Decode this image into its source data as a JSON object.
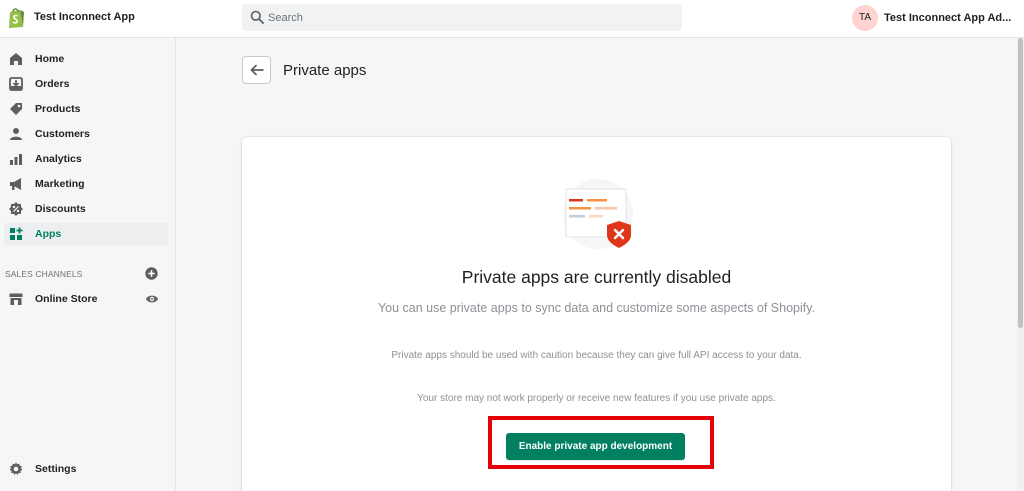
{
  "topbar": {
    "store_name": "Test Inconnect App",
    "search_placeholder": "Search",
    "user_initials": "TA",
    "user_name": "Test Inconnect App Ad..."
  },
  "sidebar": {
    "items": [
      {
        "label": "Home",
        "icon": "home-icon"
      },
      {
        "label": "Orders",
        "icon": "orders-icon"
      },
      {
        "label": "Products",
        "icon": "tag-icon"
      },
      {
        "label": "Customers",
        "icon": "person-icon"
      },
      {
        "label": "Analytics",
        "icon": "bar-chart-icon"
      },
      {
        "label": "Marketing",
        "icon": "megaphone-icon"
      },
      {
        "label": "Discounts",
        "icon": "discount-icon"
      },
      {
        "label": "Apps",
        "icon": "apps-icon",
        "active": true
      }
    ],
    "sales_channels_title": "SALES CHANNELS",
    "online_store": "Online Store",
    "settings": "Settings"
  },
  "page": {
    "title": "Private apps"
  },
  "empty_state": {
    "heading": "Private apps are currently disabled",
    "description": "You can use private apps to sync data and customize some aspects of Shopify.",
    "note_caution": "Private apps should be used with caution because they can give full API access to your data.",
    "note_store": "Your store may not work properly or receive new features if you use private apps.",
    "button_label": "Enable private app development"
  },
  "colors": {
    "accent": "#008060",
    "highlight": "#e5000a",
    "avatar": "#fed3d1"
  }
}
